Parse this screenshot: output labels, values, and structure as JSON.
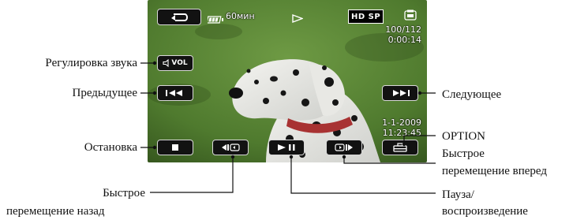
{
  "screen": {
    "battery_time": "60мин",
    "quality_badge": "HD SP",
    "file_counter": "100/112",
    "elapsed_time": "0:00:14",
    "date": "1-1-2009",
    "time": "11:23:45",
    "volume_button_label": "VOL"
  },
  "callouts": {
    "volume": "Регулировка звука",
    "previous": "Предыдущее",
    "stop": "Остановка",
    "rewind_line1": "Быстрое",
    "rewind_line2": "перемещение назад",
    "next": "Следующее",
    "option": "OPTION",
    "forward_line1": "Быстрое",
    "forward_line2": "перемещение вперед",
    "pause_line1": "Пауза/",
    "pause_line2": "воспроизведение"
  },
  "icons": {
    "back": "return-arrow-icon",
    "battery": "battery-icon",
    "play_status": "play-triangle-icon",
    "memory": "memory-card-icon",
    "volume": "speaker-icon",
    "previous": "skip-previous-icon",
    "next": "skip-next-icon",
    "stop": "stop-square-icon",
    "rewind": "slow-rewind-icon",
    "play_pause": "play-pause-icon",
    "forward": "slow-forward-icon",
    "option": "option-toolbox-icon"
  },
  "colors": {
    "lawn": "#4f7a2e",
    "hud_button": "#121212",
    "hud_border": "#d8d8d8",
    "leader_line": "#111111"
  }
}
